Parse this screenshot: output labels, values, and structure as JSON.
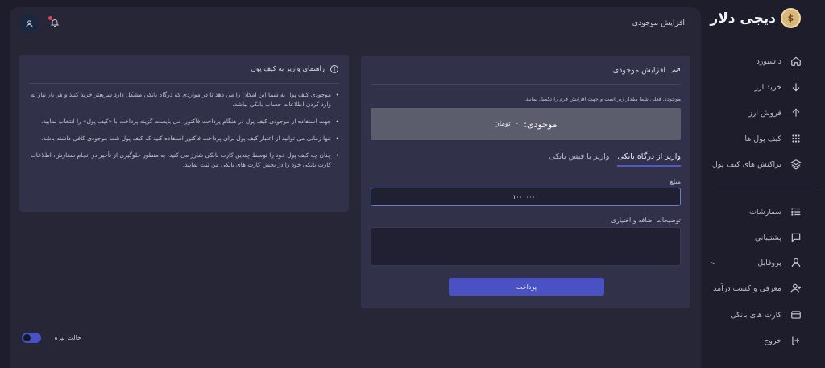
{
  "brand": {
    "name": "دیجی دلار"
  },
  "header": {
    "title": "افزایش موجودی"
  },
  "sidebar": {
    "items": [
      {
        "label": "داشبورد",
        "icon": "home-icon"
      },
      {
        "label": "خرید ارز",
        "icon": "arrow-down-icon"
      },
      {
        "label": "فروش ارز",
        "icon": "arrow-up-icon"
      },
      {
        "label": "کیف پول ها",
        "icon": "grid-icon"
      },
      {
        "label": "تراکنش های کیف پول",
        "icon": "layers-icon"
      },
      {
        "label": "سفارشات",
        "icon": "list-icon"
      },
      {
        "label": "پشتیبانی",
        "icon": "chat-icon"
      },
      {
        "label": "پروفایل",
        "icon": "user-icon"
      },
      {
        "label": "معرفی و کسب درآمد",
        "icon": "user-plus-icon"
      },
      {
        "label": "کارت های بانکی",
        "icon": "card-icon"
      },
      {
        "label": "خروج",
        "icon": "logout-icon"
      }
    ]
  },
  "deposit": {
    "title": "افزایش موجودی",
    "description": "موجودی فعلی شما مقدار زیر است و جهت افزایش فرم را تکمیل نمایید",
    "balance_label": "موجودی:",
    "balance_value": "۰",
    "balance_unit": "تومان",
    "tabs": [
      "واریز از درگاه بانکی",
      "واریز با فیش بانکی"
    ],
    "amount_label": "مبلغ",
    "amount_value": "۱۰۰۰۰۰۰۰",
    "notes_label": "توضیحات اضافه و اختیاری",
    "pay_button": "پرداخت"
  },
  "guide": {
    "title": "راهنمای واریز به کیف پول",
    "items": [
      "موجودی کیف پول به شما این امکان را می دهد تا در مواردی که درگاه بانکی مشکل دارد سریعتر خرید کنید و هر بار نیاز به وارد کردن اطلاعات حساب بانکی نباشد.",
      "جهت استفاده از موجودی کیف پول در هنگام پرداخت فاکتور، می بایست گزینه پرداخت با «کیف پول» را انتخاب نمایید.",
      "تنها زمانی می توانید از اعتبار کیف پول برای پرداخت فاکتور استفاده کنید که کیف پول شما موجودی کافی داشته باشد.",
      "چنان چه کیف پول خود را توسط چندین کارت بانکی شارژ می کنید، به منظور جلوگیری از تأخیر در انجام سفارش، اطلاعات کارت بانکی خود را در بخش کارت های بانکی من ثبت نمایید."
    ]
  },
  "dark_mode": {
    "label": "حالت تیره",
    "enabled": true
  },
  "colors": {
    "accent": "#4a52c3",
    "panel": "#262637",
    "card": "#31324a",
    "background": "#1d1d2b"
  }
}
